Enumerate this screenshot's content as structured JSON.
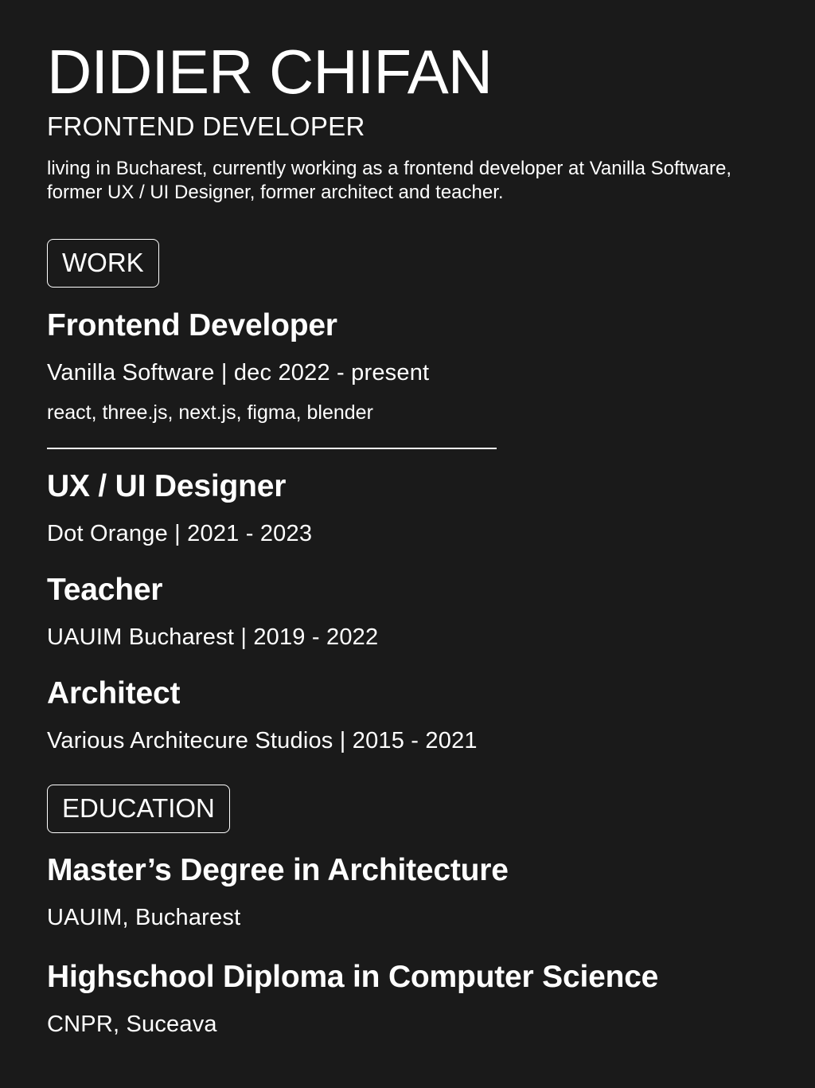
{
  "header": {
    "name": "DIDIER CHIFAN",
    "role": "FRONTEND DEVELOPER",
    "bio": "living in Bucharest, currently working as a frontend developer at Vanilla Software, former UX / UI Designer, former architect and teacher."
  },
  "work": {
    "heading": "WORK",
    "jobs": [
      {
        "title": "Frontend Developer",
        "meta": "Vanilla Software | dec 2022 - present",
        "stack": "react, three.js, next.js, figma, blender"
      },
      {
        "title": "UX / UI Designer",
        "meta": "Dot Orange | 2021 - 2023"
      },
      {
        "title": "Teacher",
        "meta": "UAUIM Bucharest | 2019 - 2022"
      },
      {
        "title": "Architect",
        "meta": "Various Architecure Studios | 2015 - 2021"
      }
    ]
  },
  "education": {
    "heading": "EDUCATION",
    "items": [
      {
        "title": "Master’s Degree in Architecture",
        "place": "UAUIM, Bucharest"
      },
      {
        "title": "Highschool Diploma in Computer Science",
        "place": "CNPR, Suceava"
      }
    ]
  },
  "colors": {
    "background": "#1a1a1a",
    "text": "#ffffff"
  }
}
